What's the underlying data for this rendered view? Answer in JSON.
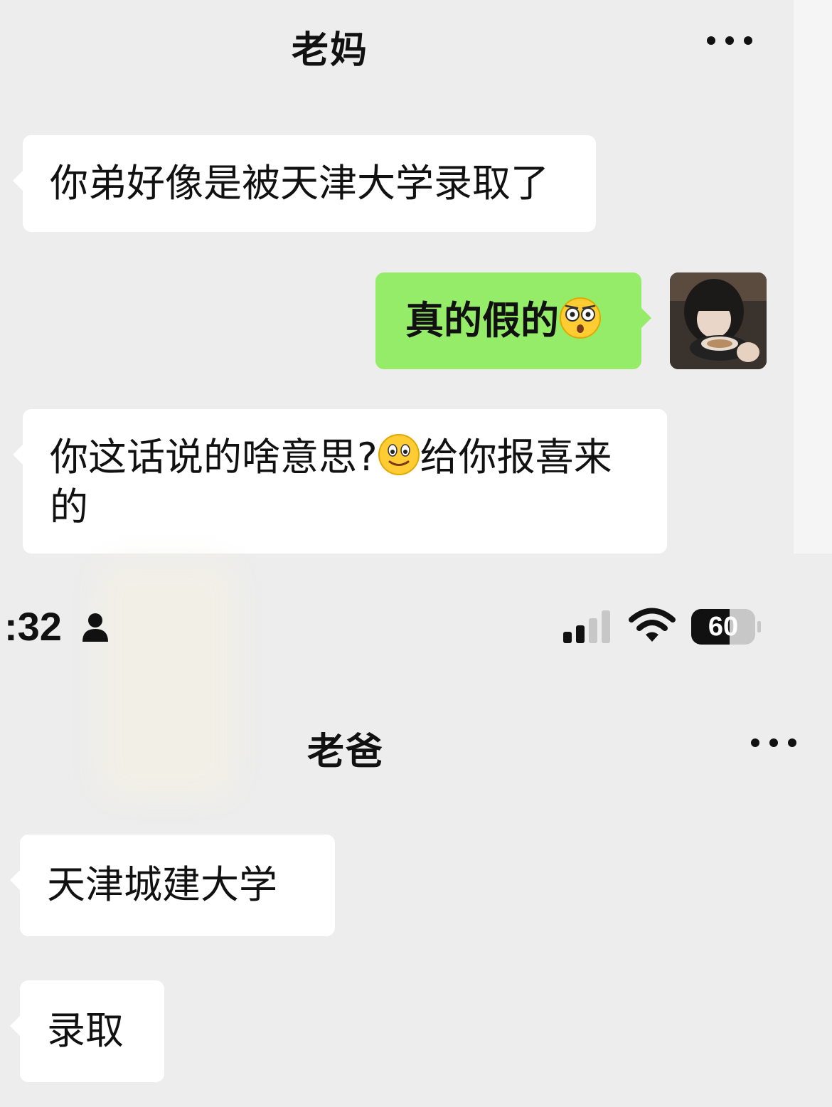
{
  "mom_chat": {
    "title": "老妈",
    "messages": [
      {
        "side": "left",
        "text": "你弟好像是被天津大学录取了"
      },
      {
        "side": "right",
        "text": "真的假的",
        "emoji": "flushed-face-emoji"
      },
      {
        "side": "left",
        "text_before": "你这话说的啥意思?",
        "emoji": "smiling-face-emoji",
        "text_after": "给你报喜来的"
      }
    ]
  },
  "status_bar": {
    "time": ":32",
    "battery": "60",
    "icons": [
      "person-icon",
      "signal-icon",
      "wifi-icon",
      "battery-icon"
    ]
  },
  "dad_chat": {
    "title": "老爸",
    "messages": [
      {
        "side": "left",
        "text": "天津城建大学"
      },
      {
        "side": "left",
        "text": "录取"
      }
    ]
  },
  "colors": {
    "background": "#ededed",
    "incoming_bubble": "#ffffff",
    "outgoing_bubble": "#95ec69"
  }
}
